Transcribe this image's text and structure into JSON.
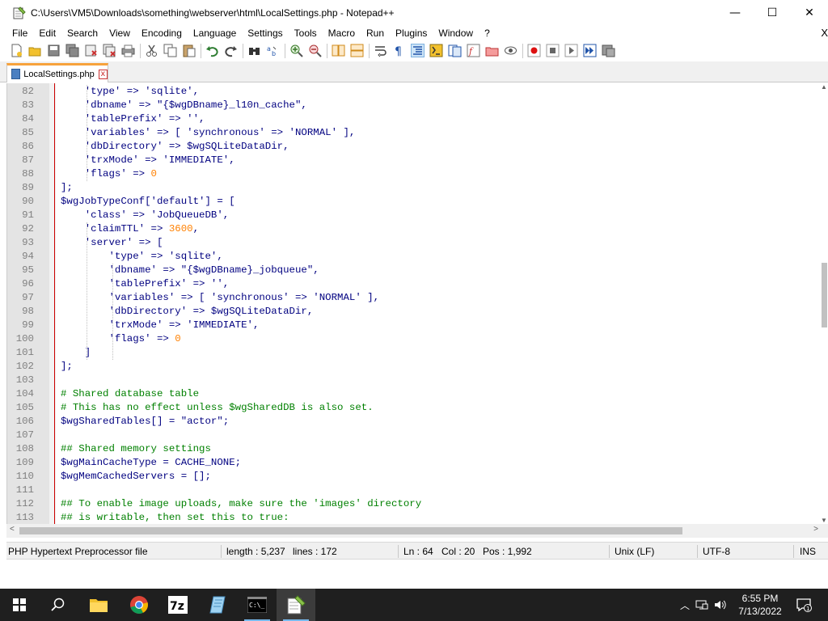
{
  "window": {
    "title": "C:\\Users\\VM5\\Downloads\\something\\webserver\\html\\LocalSettings.php - Notepad++",
    "minimize_icon": "minimize-icon",
    "maximize_icon": "maximize-icon",
    "close_icon": "close-icon",
    "minimize_glyph": "—",
    "maximize_glyph": "☐",
    "close_glyph": "✕"
  },
  "menu": {
    "items": [
      "File",
      "Edit",
      "Search",
      "View",
      "Encoding",
      "Language",
      "Settings",
      "Tools",
      "Macro",
      "Run",
      "Plugins",
      "Window",
      "?"
    ],
    "close_doc_glyph": "X"
  },
  "toolbar": {
    "icons": [
      "new-file-icon",
      "open-file-icon",
      "save-icon",
      "save-all-icon",
      "close-icon",
      "close-all-icon",
      "print-icon",
      "cut-icon",
      "copy-icon",
      "paste-icon",
      "undo-icon",
      "redo-icon",
      "find-icon",
      "replace-icon",
      "zoom-in-icon",
      "zoom-out-icon",
      "sync-vertical-icon",
      "sync-horizontal-icon",
      "word-wrap-icon",
      "show-all-characters-icon",
      "indent-guide-icon",
      "language-icon",
      "document-map-icon",
      "function-list-icon",
      "folder-as-workspace-icon",
      "monitoring-icon",
      "record-macro-icon",
      "stop-recording-icon",
      "play-macro-icon",
      "run-macro-multiple-icon",
      "save-macro-icon"
    ]
  },
  "tab": {
    "label": "LocalSettings.php",
    "close_glyph": "x"
  },
  "editor": {
    "lines": [
      {
        "n": "82",
        "text": "    'type' => 'sqlite',",
        "comment": false
      },
      {
        "n": "83",
        "text": "    'dbname' => \"{$wgDBname}_l10n_cache\",",
        "comment": false
      },
      {
        "n": "84",
        "text": "    'tablePrefix' => '',",
        "comment": false
      },
      {
        "n": "85",
        "text": "    'variables' => [ 'synchronous' => 'NORMAL' ],",
        "comment": false
      },
      {
        "n": "86",
        "text": "    'dbDirectory' => $wgSQLiteDataDir,",
        "comment": false
      },
      {
        "n": "87",
        "text": "    'trxMode' => 'IMMEDIATE',",
        "comment": false
      },
      {
        "n": "88",
        "text": "    'flags' => 0",
        "comment": false
      },
      {
        "n": "89",
        "text": "];",
        "comment": false
      },
      {
        "n": "90",
        "text": "$wgJobTypeConf['default'] = [",
        "comment": false
      },
      {
        "n": "91",
        "text": "    'class' => 'JobQueueDB',",
        "comment": false
      },
      {
        "n": "92",
        "text": "    'claimTTL' => 3600,",
        "comment": false
      },
      {
        "n": "93",
        "text": "    'server' => [",
        "comment": false
      },
      {
        "n": "94",
        "text": "        'type' => 'sqlite',",
        "comment": false
      },
      {
        "n": "95",
        "text": "        'dbname' => \"{$wgDBname}_jobqueue\",",
        "comment": false
      },
      {
        "n": "96",
        "text": "        'tablePrefix' => '',",
        "comment": false
      },
      {
        "n": "97",
        "text": "        'variables' => [ 'synchronous' => 'NORMAL' ],",
        "comment": false
      },
      {
        "n": "98",
        "text": "        'dbDirectory' => $wgSQLiteDataDir,",
        "comment": false
      },
      {
        "n": "99",
        "text": "        'trxMode' => 'IMMEDIATE',",
        "comment": false
      },
      {
        "n": "100",
        "text": "        'flags' => 0",
        "comment": false
      },
      {
        "n": "101",
        "text": "    ]",
        "comment": false
      },
      {
        "n": "102",
        "text": "];",
        "comment": false
      },
      {
        "n": "103",
        "text": "",
        "comment": false
      },
      {
        "n": "104",
        "text": "# Shared database table",
        "comment": true
      },
      {
        "n": "105",
        "text": "# This has no effect unless $wgSharedDB is also set.",
        "comment": true
      },
      {
        "n": "106",
        "text": "$wgSharedTables[] = \"actor\";",
        "comment": false
      },
      {
        "n": "107",
        "text": "",
        "comment": false
      },
      {
        "n": "108",
        "text": "## Shared memory settings",
        "comment": true
      },
      {
        "n": "109",
        "text": "$wgMainCacheType = CACHE_NONE;",
        "comment": false
      },
      {
        "n": "110",
        "text": "$wgMemCachedServers = [];",
        "comment": false
      },
      {
        "n": "111",
        "text": "",
        "comment": false
      },
      {
        "n": "112",
        "text": "## To enable image uploads, make sure the 'images' directory",
        "comment": true
      },
      {
        "n": "113",
        "text": "## is writable, then set this to true:",
        "comment": true
      }
    ]
  },
  "status": {
    "file_type": "PHP Hypertext Preprocessor file",
    "length": "length : 5,237",
    "lines": "lines : 172",
    "ln": "Ln : 64",
    "col": "Col : 20",
    "pos": "Pos : 1,992",
    "eol": "Unix (LF)",
    "encoding": "UTF-8",
    "mode": "INS"
  },
  "taskbar": {
    "apps": [
      "windows-start-icon",
      "search-icon",
      "file-explorer-icon",
      "chrome-icon",
      "7zip-icon",
      "notepad-icon",
      "terminal-icon",
      "notepad-plus-plus-icon"
    ],
    "time": "6:55 PM",
    "date": "7/13/2022",
    "notification_count": "1"
  },
  "colors": {
    "code": "#000080",
    "comment": "#008000",
    "number": "#ff8000",
    "line_number": "#808080",
    "tab_accent": "#f7a23c",
    "fold_line": "#cc0000"
  }
}
